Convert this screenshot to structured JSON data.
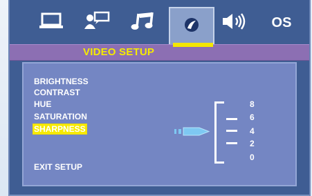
{
  "tabs": [
    {
      "id": "general",
      "icon": "monitor-icon"
    },
    {
      "id": "language",
      "icon": "speech-icon"
    },
    {
      "id": "audio",
      "icon": "music-note-icon"
    },
    {
      "id": "video",
      "icon": "video-disc-icon",
      "selected": true
    },
    {
      "id": "speaker",
      "icon": "speaker-icon"
    },
    {
      "id": "os",
      "label": "OS"
    }
  ],
  "title": "VIDEO SETUP",
  "menu": {
    "items": [
      {
        "label": "BRIGHTNESS"
      },
      {
        "label": "CONTRAST"
      },
      {
        "label": "HUE"
      },
      {
        "label": "SATURATION"
      },
      {
        "label": "SHARPNESS",
        "selected": true
      }
    ],
    "exit_label": "EXIT SETUP"
  },
  "scale": {
    "labels": [
      "8",
      "6",
      "4",
      "2",
      "0"
    ],
    "current_value": 4
  },
  "colors": {
    "frame": "#3f5d93",
    "panel": "#7486c3",
    "title_strip": "#8c6fb3",
    "highlight": "#f6ea00",
    "selected_tab": "#8aa0ca",
    "pointer": "#7ec8f2"
  }
}
